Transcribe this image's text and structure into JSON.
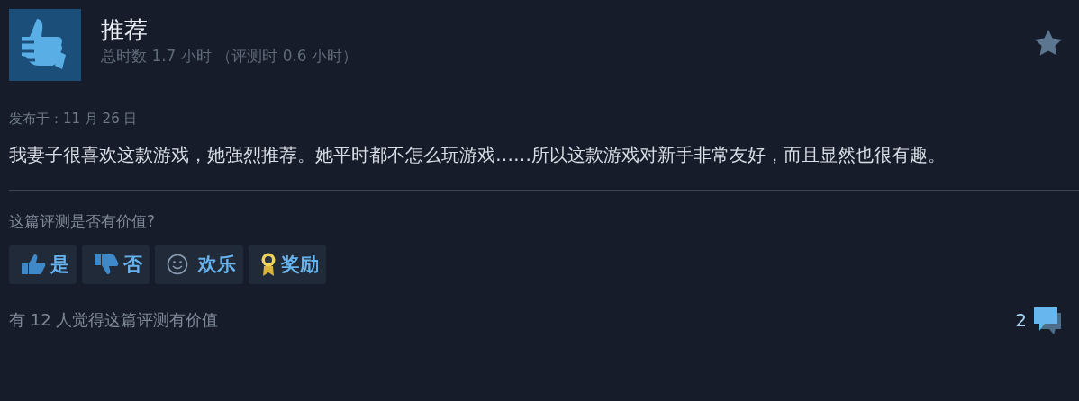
{
  "review": {
    "title": "推荐",
    "playtime": "总时数 1.7 小时 （评测时 0.6 小时）",
    "posted": "发布于：11 月 26 日",
    "body": "我妻子很喜欢这款游戏，她强烈推荐。她平时都不怎么玩游戏……所以这款游戏对新手非常友好，而且显然也很有趣。"
  },
  "helpful": {
    "question": "这篇评测是否有价值?",
    "buttons": [
      {
        "kind": "yes",
        "label": "是"
      },
      {
        "kind": "no",
        "label": "否"
      },
      {
        "kind": "funny",
        "label": "欢乐"
      },
      {
        "kind": "award",
        "label": "奖励"
      }
    ],
    "summary": "有 12 人觉得这篇评测有价值",
    "comment_count": "2"
  }
}
